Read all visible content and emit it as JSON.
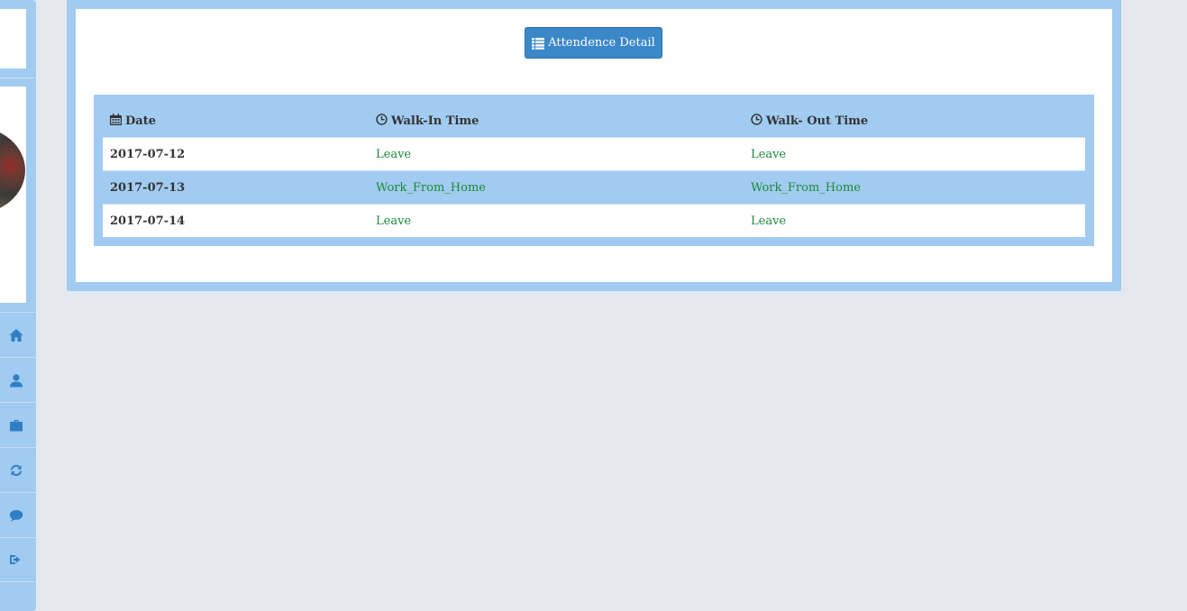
{
  "sidebar": {
    "nav_items": [
      {
        "icon": "home-icon",
        "name": "sidebar-item-home"
      },
      {
        "icon": "user-icon",
        "name": "sidebar-item-profile"
      },
      {
        "icon": "briefcase-icon",
        "name": "sidebar-item-work"
      },
      {
        "icon": "refresh-icon",
        "name": "sidebar-item-refresh"
      },
      {
        "icon": "comment-icon",
        "name": "sidebar-item-messages"
      },
      {
        "icon": "sign-out-icon",
        "name": "sidebar-item-logout"
      }
    ]
  },
  "main": {
    "detail_button_label": "Attendence Detail",
    "table": {
      "headers": [
        "Date",
        "Walk-In Time",
        "Walk- Out Time"
      ],
      "rows": [
        [
          "2017-07-12",
          "Leave",
          "Leave"
        ],
        [
          "2017-07-13",
          "Work_From_Home",
          "Work_From_Home"
        ],
        [
          "2017-07-14",
          "Leave",
          "Leave"
        ]
      ]
    }
  },
  "colors": {
    "accent": "#a1cbf0",
    "button": "#3b88c9",
    "status_text": "#1e8a3a",
    "background": "#e4e8ee"
  }
}
